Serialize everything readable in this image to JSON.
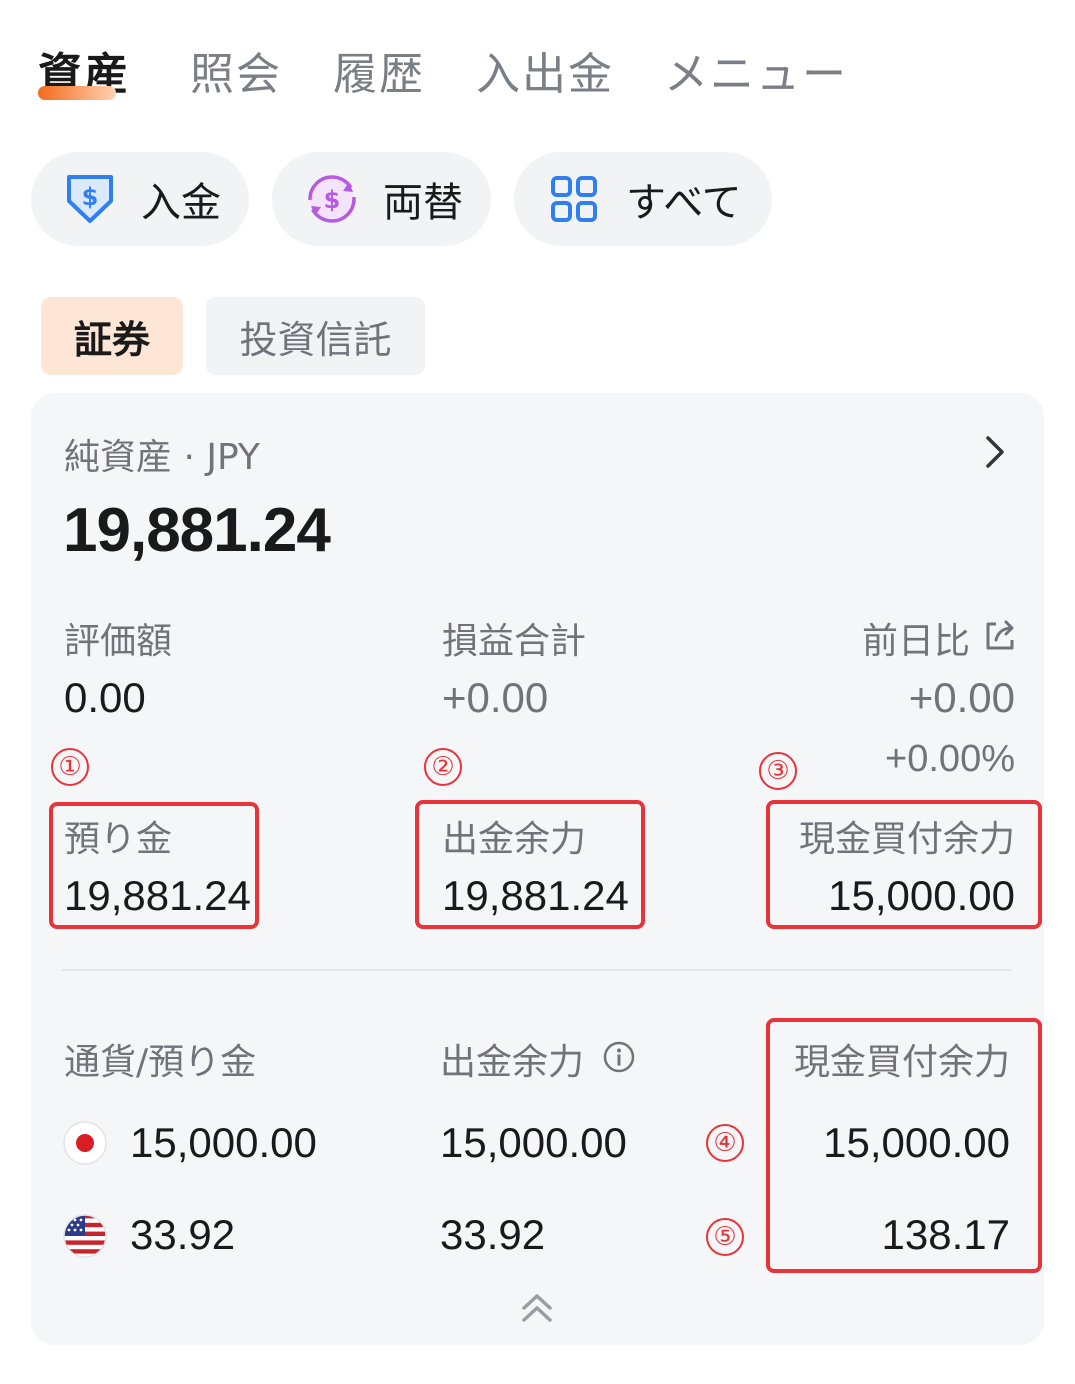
{
  "nav": {
    "tabs": [
      {
        "label": "資産",
        "active": true
      },
      {
        "label": "照会",
        "active": false
      },
      {
        "label": "履歴",
        "active": false
      },
      {
        "label": "入出金",
        "active": false
      },
      {
        "label": "メニュー",
        "active": false
      }
    ]
  },
  "actions": [
    {
      "label": "入金",
      "icon": "deposit-shield-icon",
      "color": "#2f7ff0"
    },
    {
      "label": "両替",
      "icon": "exchange-icon",
      "color": "#b75ae0"
    },
    {
      "label": "すべて",
      "icon": "grid-icon",
      "color": "#2f7ff0"
    }
  ],
  "segments": [
    {
      "label": "証券",
      "active": true
    },
    {
      "label": "投資信託",
      "active": false
    }
  ],
  "summary": {
    "title": "純資産 · JPY",
    "net_assets": "19,881.24",
    "valuation_label": "評価額",
    "valuation_value": "0.00",
    "pl_label": "損益合計",
    "pl_value": "+0.00",
    "day_change_label": "前日比",
    "day_change_value": "+0.00",
    "day_change_pct": "+0.00%",
    "deposit_label": "預り金",
    "deposit_value": "19,881.24",
    "withdrawable_label": "出金余力",
    "withdrawable_value": "19,881.24",
    "cash_buying_label": "現金買付余力",
    "cash_buying_value": "15,000.00"
  },
  "currency_table": {
    "col1_label": "通貨/預り金",
    "col2_label": "出金余力",
    "col3_label": "現金買付余力",
    "rows": [
      {
        "flag": "japan-flag-icon",
        "deposit": "15,000.00",
        "withdrawable": "15,000.00",
        "cash_buying": "15,000.00"
      },
      {
        "flag": "us-flag-icon",
        "deposit": "33.92",
        "withdrawable": "33.92",
        "cash_buying": "138.17"
      }
    ]
  },
  "annotations": [
    "①",
    "②",
    "③",
    "④",
    "⑤"
  ],
  "colors": {
    "accent": "#f26a1b",
    "annotation_red": "#e8333b",
    "card_bg": "#f5f6f8"
  }
}
